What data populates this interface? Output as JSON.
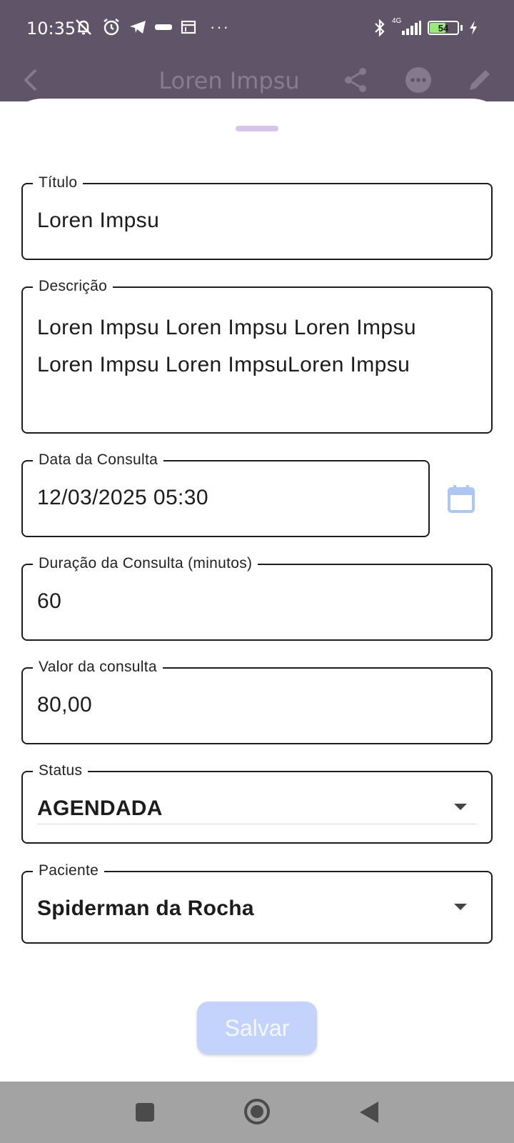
{
  "status_bar": {
    "time": "10:35",
    "network": "4G",
    "battery": "54",
    "more_indicator": "···"
  },
  "app_bar": {
    "title": "Loren Impsu"
  },
  "form": {
    "titulo": {
      "label": "Título",
      "value": "Loren Impsu"
    },
    "descricao": {
      "label": "Descrição",
      "line1": "Loren Impsu Loren Impsu Loren Impsu",
      "line2": "Loren Impsu Loren ImpsuLoren Impsu"
    },
    "data": {
      "label": "Data da Consulta",
      "value": "12/03/2025 05:30"
    },
    "duracao": {
      "label": "Duração da Consulta (minutos)",
      "value": "60"
    },
    "valor": {
      "label": "Valor da consulta",
      "value": "80,00"
    },
    "status": {
      "label": "Status",
      "value": "AGENDADA"
    },
    "paciente": {
      "label": "Paciente",
      "value": "Spiderman da Rocha"
    }
  },
  "save_label": "Salvar",
  "colors": {
    "app_bar_bg": "#5f5468",
    "save_button_bg": "#c3d3fb",
    "calendar_icon": "#aec6f2",
    "drag_handle": "#d7c4ea"
  }
}
